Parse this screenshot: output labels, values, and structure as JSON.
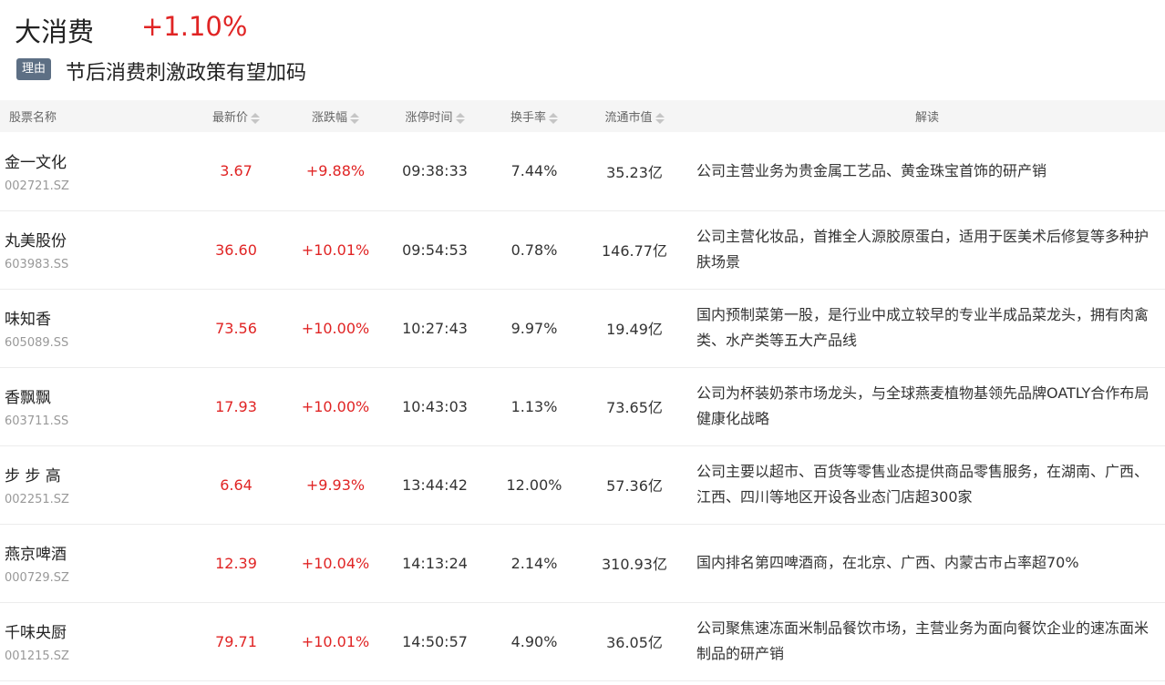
{
  "header": {
    "title": "大消费",
    "change": "+1.10%",
    "reason_tag": "理由",
    "reason_text": "节后消费刺激政策有望加码"
  },
  "table": {
    "columns": [
      "股票名称",
      "最新价",
      "涨跌幅",
      "涨停时间",
      "换手率",
      "流通市值",
      "解读"
    ],
    "rows": [
      {
        "name": "金一文化",
        "code": "002721.SZ",
        "price": "3.67",
        "change": "+9.88%",
        "time": "09:38:33",
        "turnover": "7.44%",
        "cap": "35.23亿",
        "desc": "公司主营业务为贵金属工艺品、黄金珠宝首饰的研产销"
      },
      {
        "name": "丸美股份",
        "code": "603983.SS",
        "price": "36.60",
        "change": "+10.01%",
        "time": "09:54:53",
        "turnover": "0.78%",
        "cap": "146.77亿",
        "desc": "公司主营化妆品，首推全人源胶原蛋白，适用于医美术后修复等多种护肤场景"
      },
      {
        "name": "味知香",
        "code": "605089.SS",
        "price": "73.56",
        "change": "+10.00%",
        "time": "10:27:43",
        "turnover": "9.97%",
        "cap": "19.49亿",
        "desc": "国内预制菜第一股，是行业中成立较早的专业半成品菜龙头，拥有肉禽类、水产类等五大产品线"
      },
      {
        "name": "香飘飘",
        "code": "603711.SS",
        "price": "17.93",
        "change": "+10.00%",
        "time": "10:43:03",
        "turnover": "1.13%",
        "cap": "73.65亿",
        "desc": "公司为杯装奶茶市场龙头，与全球燕麦植物基领先品牌OATLY合作布局健康化战略"
      },
      {
        "name": "步 步 高",
        "code": "002251.SZ",
        "price": "6.64",
        "change": "+9.93%",
        "time": "13:44:42",
        "turnover": "12.00%",
        "cap": "57.36亿",
        "desc": "公司主要以超市、百货等零售业态提供商品零售服务，在湖南、广西、江西、四川等地区开设各业态门店超300家"
      },
      {
        "name": "燕京啤酒",
        "code": "000729.SZ",
        "price": "12.39",
        "change": "+10.04%",
        "time": "14:13:24",
        "turnover": "2.14%",
        "cap": "310.93亿",
        "desc": "国内排名第四啤酒商，在北京、广西、内蒙古市占率超70%"
      },
      {
        "name": "千味央厨",
        "code": "001215.SZ",
        "price": "79.71",
        "change": "+10.01%",
        "time": "14:50:57",
        "turnover": "4.90%",
        "cap": "36.05亿",
        "desc": "公司聚焦速冻面米制品餐饮市场，主营业务为面向餐饮企业的速冻面米制品的研产销"
      }
    ]
  }
}
